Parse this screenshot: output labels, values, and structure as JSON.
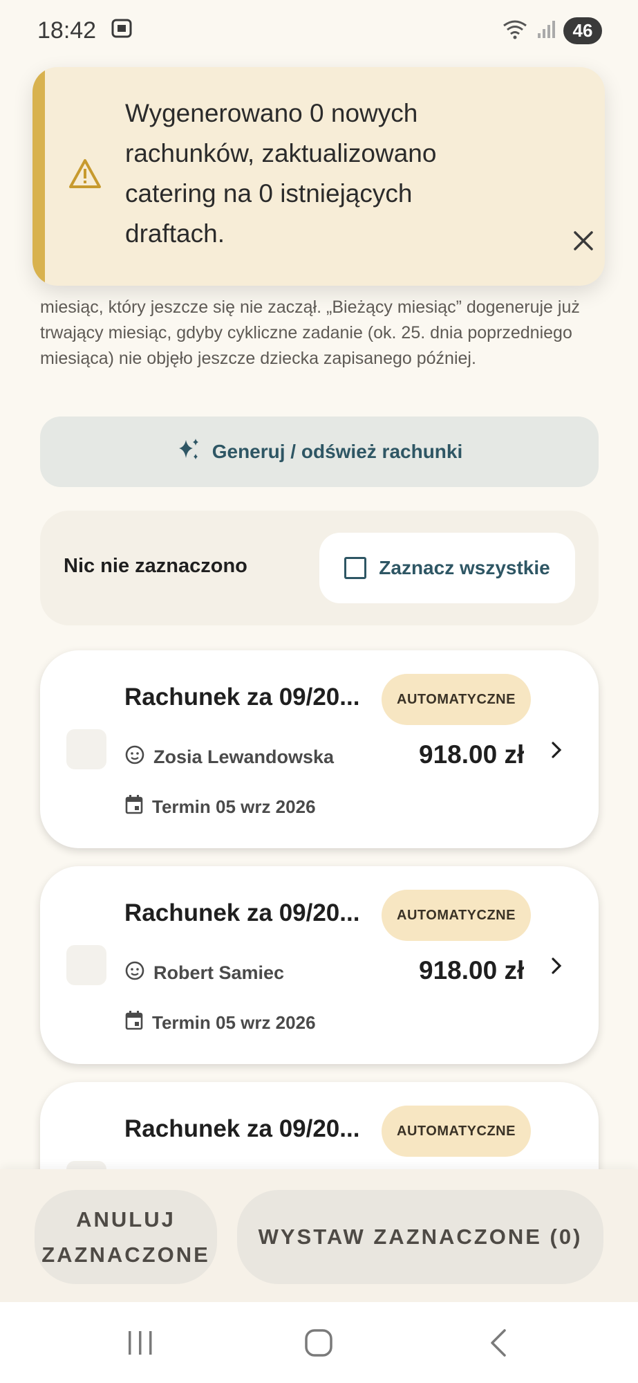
{
  "status_bar": {
    "time": "18:42",
    "battery": "46"
  },
  "snackbar": {
    "message": "Wygenerowano 0 nowych rachunków, zaktualizowano catering na 0 istniejących draftach.",
    "icon": "warning-icon",
    "close_icon": "close-icon"
  },
  "description": "miesiąc, który jeszcze się nie zaczął. „Bieżący miesiąc” dogeneruje już trwający miesiąc, gdyby cykliczne zadanie (ok. 25. dnia poprzedniego miesiąca) nie objęło jeszcze dziecka zapisanego później.",
  "generate_button": {
    "label": "Generuj / odśwież rachunki",
    "icon": "sparkle-icon"
  },
  "selection": {
    "status": "Nic nie zaznaczono",
    "select_all_label": "Zaznacz wszystkie"
  },
  "bills": [
    {
      "title": "Rachunek za 09/20...",
      "badge": "AUTOMATYCZNE",
      "child": "Zosia Lewandowska",
      "amount": "918.00 zł",
      "due": "Termin 05 wrz 2026"
    },
    {
      "title": "Rachunek za 09/20...",
      "badge": "AUTOMATYCZNE",
      "child": "Robert Samiec",
      "amount": "918.00 zł",
      "due": "Termin 05 wrz 2026"
    },
    {
      "title": "Rachunek za 09/20...",
      "badge": "AUTOMATYCZNE"
    }
  ],
  "actions": {
    "cancel_label": "ANULUJ\nZAZNACZONE",
    "issue_label": "WYSTAW ZAZNACZONE (0)"
  },
  "colors": {
    "background": "#FBF8F1",
    "accent": "#2E5664",
    "warning_stripe": "#D8B24F",
    "badge_bg": "#F7E6C2"
  }
}
